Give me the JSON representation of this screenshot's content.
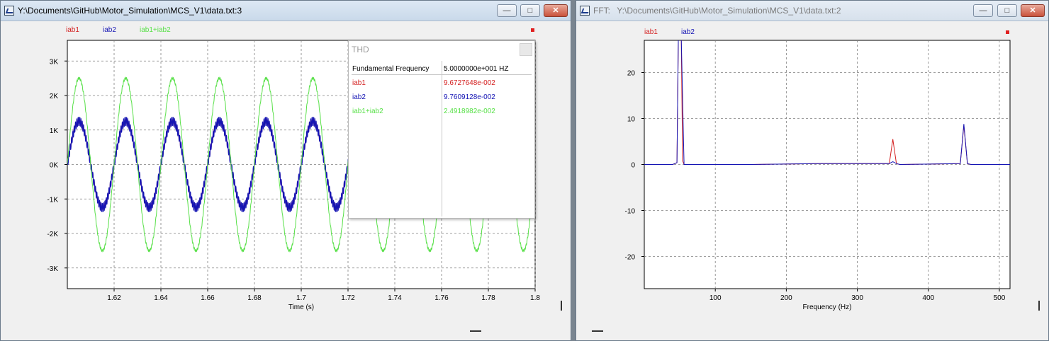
{
  "left_window": {
    "title": "Y:\\Documents\\GitHub\\Motor_Simulation\\MCS_V1\\data.txt:3",
    "buttons": {
      "minimize": "—",
      "maximize": "□",
      "close": "✕"
    }
  },
  "right_window": {
    "title_prefix": "FFT:",
    "title": "Y:\\Documents\\GitHub\\Motor_Simulation\\MCS_V1\\data.txt:2",
    "buttons": {
      "minimize": "—",
      "maximize": "□",
      "close": "✕"
    }
  },
  "colors": {
    "iab1": "#d42020",
    "iab2": "#1414b4",
    "iab1_plus_iab2": "#58e048",
    "grid": "#808080",
    "marker": "#e02020"
  },
  "thd": {
    "title": "THD",
    "rows": [
      {
        "label": "Fundamental Frequency",
        "value": "5.0000000e+001 HZ",
        "color": "#000000"
      },
      {
        "label": "iab1",
        "value": "9.6727648e-002",
        "color": "#d42020"
      },
      {
        "label": "iab2",
        "value": "9.7609128e-002",
        "color": "#1414b4"
      },
      {
        "label": "iab1+iab2",
        "value": "2.4918982e-002",
        "color": "#58e048"
      }
    ]
  },
  "chart_data": [
    {
      "type": "line",
      "xlabel": "Time (s)",
      "ylabel": "",
      "xlim": [
        1.6,
        1.8
      ],
      "ylim": [
        -3.6,
        3.6
      ],
      "xticks": [
        1.62,
        1.64,
        1.66,
        1.68,
        1.7,
        1.72,
        1.74,
        1.76,
        1.78,
        1.8
      ],
      "xtick_labels": [
        "1.62",
        "1.64",
        "1.66",
        "1.68",
        "1.7",
        "1.72",
        "1.74",
        "1.76",
        "1.78",
        "1.8"
      ],
      "yticks": [
        3,
        2,
        1,
        0,
        -1,
        -2,
        -3
      ],
      "ytick_labels": [
        "3K",
        "2K",
        "1K",
        "0K",
        "-1K",
        "-2K",
        "-3K"
      ],
      "legend": [
        "iab1",
        "iab2",
        "iab1+iab2"
      ],
      "legend_placement": "top-left",
      "series": [
        {
          "name": "iab1",
          "frequency_hz": 50,
          "amplitude_k": 1.25,
          "phase_deg": 0,
          "ripple_k": 0.08,
          "color": "#d42020"
        },
        {
          "name": "iab2",
          "frequency_hz": 50,
          "amplitude_k": 1.25,
          "phase_deg": 0,
          "ripple_k": 0.12,
          "color": "#1414b4"
        },
        {
          "name": "iab1+iab2",
          "frequency_hz": 50,
          "amplitude_k": 2.5,
          "phase_deg": 0,
          "ripple_k": 0.03,
          "color": "#58e048"
        }
      ],
      "grid": true
    },
    {
      "type": "line",
      "xlabel": "Frequency (Hz)",
      "ylabel": "",
      "xlim": [
        0,
        515
      ],
      "ylim": [
        -27,
        27
      ],
      "xticks": [
        100,
        200,
        300,
        400,
        500
      ],
      "xtick_labels": [
        "100",
        "200",
        "300",
        "400",
        "500"
      ],
      "yticks": [
        20,
        10,
        0,
        -10,
        -20
      ],
      "ytick_labels": [
        "20",
        "10",
        "0",
        "-10",
        "-20"
      ],
      "legend": [
        "iab1",
        "iab2"
      ],
      "legend_placement": "top-left",
      "series": [
        {
          "name": "iab1",
          "color": "#d42020",
          "x": [
            0,
            40,
            46,
            48,
            50,
            52,
            54,
            56,
            60,
            70,
            80,
            150,
            250,
            345,
            350,
            355,
            360,
            445,
            450,
            455,
            460,
            515
          ],
          "y": [
            0,
            0,
            0.4,
            28,
            28,
            28,
            0.8,
            0,
            0,
            0,
            0,
            0,
            0.2,
            0.2,
            5.5,
            0.2,
            0,
            0.2,
            8.5,
            0.2,
            0,
            0
          ]
        },
        {
          "name": "iab2",
          "color": "#1414b4",
          "x": [
            0,
            40,
            46,
            48,
            50,
            52,
            54,
            56,
            60,
            70,
            80,
            150,
            250,
            345,
            350,
            355,
            360,
            445,
            450,
            455,
            460,
            515
          ],
          "y": [
            0,
            0,
            0.4,
            28,
            28,
            28,
            14,
            0,
            0,
            0,
            0,
            0,
            0.2,
            0.2,
            0.6,
            0.2,
            0,
            0.2,
            8.8,
            0.2,
            0,
            0
          ]
        }
      ],
      "grid": true
    }
  ]
}
